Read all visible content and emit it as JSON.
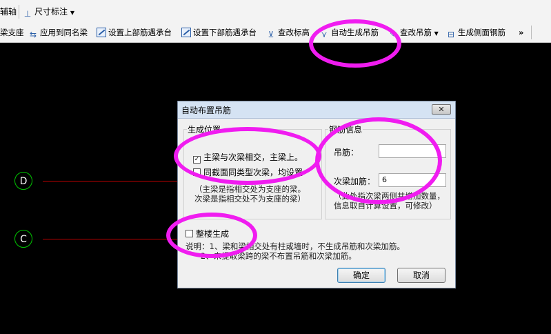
{
  "toolbar_top": {
    "axis_label": "辅轴",
    "dimension_label": "尺寸标注"
  },
  "toolbar": {
    "items": [
      "梁支座",
      "应用到同名梁",
      "设置上部筋遇承台",
      "设置下部筋遇承台",
      "查改标高",
      "自动生成吊筋",
      "查改吊筋",
      "生成侧面钢筋"
    ],
    "overflow": "»"
  },
  "canvas": {
    "axes": [
      "D",
      "C"
    ]
  },
  "dialog": {
    "title": "自动布置吊筋",
    "close": "✕",
    "position_group": {
      "label": "生成位置",
      "option1": "主梁与次梁相交，主梁上。",
      "option1_checked": true,
      "option2": "同截面同类型次梁，均设置",
      "option2_checked": false,
      "note_line1": "（主梁是指相交处为支座的梁。",
      "note_line2": "次梁是指相交处不为支座的梁）"
    },
    "rebar_group": {
      "label": "钢筋信息",
      "hanger_label": "吊筋：",
      "hanger_value": "",
      "secondary_label": "次梁加筋：",
      "secondary_value": "6",
      "note_line1": "（此处指次梁两侧共增加数量，",
      "note_line2": "信息取自计算设置，可修改）"
    },
    "whole_floor": {
      "label": "整楼生成",
      "checked": false
    },
    "explain_line1": "说明：1、梁和梁相交处有柱或墙时，不生成吊筋和次梁加筋。",
    "explain_line2": "      2、未提取梁跨的梁不布置吊筋和次梁加筋。",
    "ok": "确定",
    "cancel": "取消"
  }
}
